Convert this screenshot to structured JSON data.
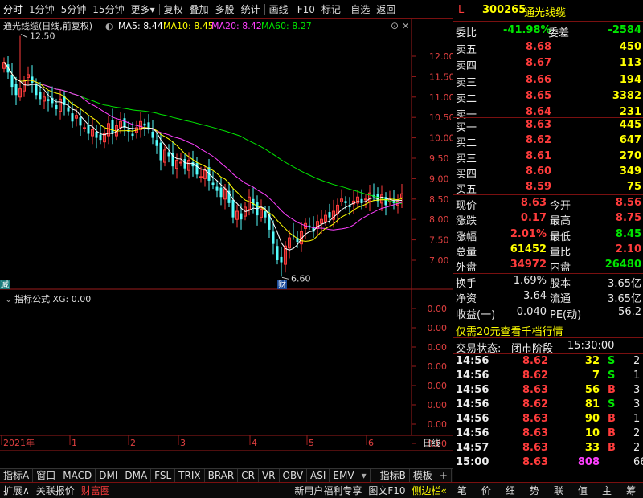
{
  "toolbar": {
    "items": [
      "分时",
      "1分钟",
      "5分钟",
      "15分钟",
      "更多",
      "复权",
      "叠加",
      "多股",
      "统计",
      "画线",
      "F10",
      "标记",
      "-自选",
      "返回"
    ]
  },
  "chart": {
    "title": "通光线缆(日线,前复权)",
    "ma_labels": [
      {
        "text": "MA5: 8.44",
        "color": "#ffffff"
      },
      {
        "text": "MA10: 8.45",
        "color": "#ffff00"
      },
      {
        "text": "MA20: 8.42",
        "color": "#ff40ff"
      },
      {
        "text": "MA60: 8.27",
        "color": "#00e600"
      }
    ],
    "y_ticks": [
      "12.00",
      "11.50",
      "11.00",
      "10.50",
      "10.00",
      "9.50",
      "9.00",
      "8.50",
      "8.00",
      "7.50",
      "7.00"
    ],
    "high_label": "12.50",
    "low_label": "6.60",
    "marker_left": "减",
    "marker_cai": "财"
  },
  "indicator": {
    "title": "指标公式 XG: 0.00",
    "y_ticks": [
      "0.00",
      "0.00",
      "0.00",
      "0.00",
      "0.00",
      "0.00",
      "0.00",
      "0.00"
    ]
  },
  "x_axis": {
    "labels": [
      "2021年",
      "1",
      "2",
      "3",
      "4",
      "5",
      "6"
    ],
    "right_label": "日线"
  },
  "tabs": [
    "指标A",
    "窗口",
    "MACD",
    "DMI",
    "DMA",
    "FSL",
    "TRIX",
    "BRAR",
    "CR",
    "VR",
    "OBV",
    "ASI",
    "EMV",
    "▾",
    "指标B",
    "模板",
    "+",
    "-"
  ],
  "quote": {
    "prefix": "L",
    "code": "300265",
    "name": "通光线缆",
    "weibi_label": "委比",
    "weibi_value": "-41.98%",
    "weicha_label": "委差",
    "weicha_value": "-2584",
    "asks": [
      {
        "label": "卖五",
        "price": "8.68",
        "vol": "450"
      },
      {
        "label": "卖四",
        "price": "8.67",
        "vol": "113"
      },
      {
        "label": "卖三",
        "price": "8.66",
        "vol": "194"
      },
      {
        "label": "卖二",
        "price": "8.65",
        "vol": "3382"
      },
      {
        "label": "卖一",
        "price": "8.64",
        "vol": "231"
      }
    ],
    "bids": [
      {
        "label": "买一",
        "price": "8.63",
        "vol": "445"
      },
      {
        "label": "买二",
        "price": "8.62",
        "vol": "647"
      },
      {
        "label": "买三",
        "price": "8.61",
        "vol": "270"
      },
      {
        "label": "买四",
        "price": "8.60",
        "vol": "349"
      },
      {
        "label": "买五",
        "price": "8.59",
        "vol": "75"
      }
    ],
    "stats": [
      {
        "l1": "现价",
        "v1": "8.63",
        "c1": "red",
        "l2": "今开",
        "v2": "8.56",
        "c2": "red"
      },
      {
        "l1": "涨跌",
        "v1": "0.17",
        "c1": "red",
        "l2": "最高",
        "v2": "8.75",
        "c2": "red"
      },
      {
        "l1": "涨幅",
        "v1": "2.01%",
        "c1": "red",
        "l2": "最低",
        "v2": "8.45",
        "c2": "green"
      },
      {
        "l1": "总量",
        "v1": "61452",
        "c1": "yellow",
        "l2": "量比",
        "v2": "2.10",
        "c2": "red"
      },
      {
        "l1": "外盘",
        "v1": "34972",
        "c1": "red",
        "l2": "内盘",
        "v2": "26480",
        "c2": "green"
      }
    ],
    "stats2": [
      {
        "l1": "换手",
        "v1": "1.69%",
        "l2": "股本",
        "v2": "3.65亿"
      },
      {
        "l1": "净资",
        "v1": "3.64",
        "l2": "流通",
        "v2": "3.65亿"
      },
      {
        "l1": "收益(一)",
        "v1": "0.040",
        "l2": "PE(动)",
        "v2": "56.2"
      }
    ],
    "promo": "仅需20元查看千档行情",
    "status_label": "交易状态:",
    "status_value": "闭市阶段",
    "status_time": "15:30:00",
    "ticks": [
      {
        "time": "14:56",
        "price": "8.62",
        "vol": "32",
        "bs": "S",
        "n": "2",
        "pc": "red",
        "bc": "green"
      },
      {
        "time": "14:56",
        "price": "8.62",
        "vol": "7",
        "bs": "S",
        "n": "1",
        "pc": "red",
        "bc": "green"
      },
      {
        "time": "14:56",
        "price": "8.63",
        "vol": "56",
        "bs": "B",
        "n": "3",
        "pc": "red",
        "bc": "red"
      },
      {
        "time": "14:56",
        "price": "8.62",
        "vol": "81",
        "bs": "S",
        "n": "3",
        "pc": "red",
        "bc": "green"
      },
      {
        "time": "14:56",
        "price": "8.63",
        "vol": "90",
        "bs": "B",
        "n": "1",
        "pc": "red",
        "bc": "red"
      },
      {
        "time": "14:56",
        "price": "8.63",
        "vol": "10",
        "bs": "B",
        "n": "2",
        "pc": "red",
        "bc": "red"
      },
      {
        "time": "14:57",
        "price": "8.63",
        "vol": "33",
        "bs": "B",
        "n": "2",
        "pc": "red",
        "bc": "red"
      },
      {
        "time": "15:00",
        "price": "8.63",
        "vol": "808",
        "bs": "",
        "n": "66",
        "pc": "red",
        "bc": "red"
      }
    ]
  },
  "bottom": {
    "left": [
      "扩展∧",
      "关联报价",
      "财富圈"
    ],
    "middle": [
      "新用户福利专享",
      "图文F10",
      "侧边栏"
    ],
    "right": [
      "笔",
      "价",
      "细",
      "势",
      "联",
      "值",
      "主",
      "筹"
    ]
  }
}
